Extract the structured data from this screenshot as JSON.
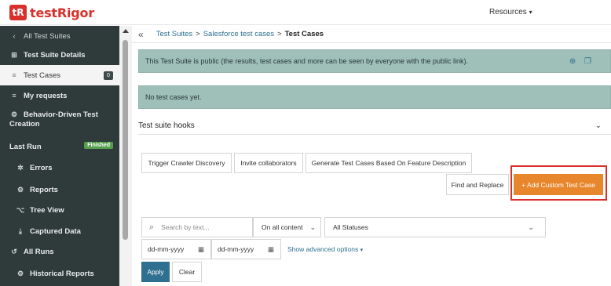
{
  "brand": {
    "badge": "tR",
    "name": "testRigor"
  },
  "header": {
    "resources_label": "Resources",
    "caret": "▾"
  },
  "sidebar": {
    "items": [
      {
        "label": "All Test Suites",
        "icon": "‹"
      },
      {
        "label": "Test Suite Details",
        "icon": "⊞"
      },
      {
        "label": "Test Cases",
        "icon": "≡",
        "count": "0"
      },
      {
        "label": "My requests",
        "icon": "≡"
      },
      {
        "label": "Behavior-Driven Test",
        "label2": "Creation",
        "icon": "⚙"
      },
      {
        "label": "Last Run",
        "badge": "Finished"
      },
      {
        "label": "Errors",
        "icon": "✲"
      },
      {
        "label": "Reports",
        "icon": "⚙"
      },
      {
        "label": "Tree View",
        "icon": "⌥"
      },
      {
        "label": "Captured Data",
        "icon": "⤓"
      },
      {
        "label": "All Runs",
        "icon": "↺"
      },
      {
        "label": "Historical Reports",
        "icon": "⚙"
      }
    ]
  },
  "breadcrumb": {
    "collapse": "«",
    "items": [
      "Test Suites",
      "Salesforce test cases",
      "Test Cases"
    ],
    "separator": ">"
  },
  "alerts": {
    "public_notice": "This Test Suite is public (the results, test cases and more can be seen by everyone with the public link).",
    "empty_notice": "No test cases yet.",
    "icons": "⊕ ❐"
  },
  "hooks": {
    "title": "Test suite hooks",
    "chevron": "⌄"
  },
  "actions": {
    "trigger_crawler": "Trigger Crawler Discovery",
    "invite": "Invite collaborators",
    "generate": "Generate Test Cases Based On Feature Description",
    "find_replace": "Find and Replace",
    "add_custom": "+  Add Custom Test Case"
  },
  "filters": {
    "search_icon": "⌕",
    "search_placeholder": "Search by text...",
    "content_scope": "On all content",
    "status": "All Statuses",
    "date_from": "dd-mm-yyyy",
    "date_to": "dd-mm-yyyy",
    "calendar_icon": "▦",
    "advanced": "Show advanced options",
    "advanced_caret": "▾",
    "apply": "Apply",
    "clear": "Clear",
    "select_caret": "⌄"
  },
  "colors": {
    "brand": "#d9302b",
    "sidebar": "#2f3a3a",
    "alert": "#9fbfb9",
    "primary": "#e8862c",
    "link": "#2f6f8f"
  }
}
